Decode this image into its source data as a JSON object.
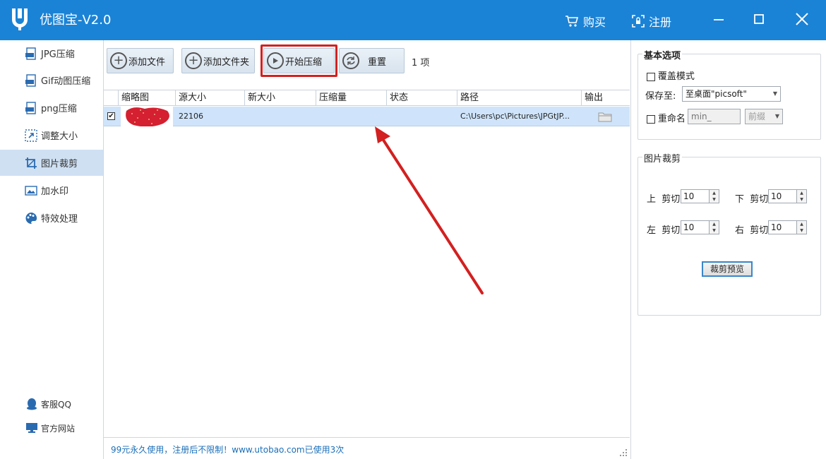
{
  "app": {
    "title": "优图宝-V2.0",
    "buy_label": "购买",
    "register_label": "注册"
  },
  "sidebar": {
    "items": [
      {
        "label": "JPG压缩",
        "icon": "jpg-icon"
      },
      {
        "label": "Gif动图压缩",
        "icon": "gif-icon"
      },
      {
        "label": "png压缩",
        "icon": "png-icon"
      },
      {
        "label": "调整大小",
        "icon": "resize-icon"
      },
      {
        "label": "图片裁剪",
        "icon": "crop-icon",
        "active": true
      },
      {
        "label": "加水印",
        "icon": "watermark-icon"
      },
      {
        "label": "特效处理",
        "icon": "palette-icon"
      }
    ],
    "bottom": [
      {
        "label": "客服QQ",
        "icon": "qq-icon"
      },
      {
        "label": "官方网站",
        "icon": "monitor-icon"
      }
    ]
  },
  "toolbar": {
    "add_file": "添加文件",
    "add_folder": "添加文件夹",
    "start": "开始压缩",
    "reset": "重置",
    "count": "1 项"
  },
  "table": {
    "columns": [
      "缩略图",
      "源大小",
      "新大小",
      "压缩量",
      "状态",
      "路径",
      "输出"
    ],
    "rows": [
      {
        "checked": true,
        "source_size": "22106",
        "new_size": "",
        "reduction": "",
        "status": "",
        "path": "C:\\Users\\pc\\Pictures\\JPGtJP..."
      }
    ]
  },
  "status_bar": {
    "text": "99元永久使用，注册后不限制！www.utobao.com已使用3次"
  },
  "basic_options": {
    "title": "基本选项",
    "overwrite_label": "覆盖模式",
    "save_to_label": "保存至:",
    "save_to_value": "至桌面\"picsoft\"",
    "rename_label": "重命名",
    "rename_placeholder": "min_",
    "prefix_value": "前缀"
  },
  "crop": {
    "title": "图片裁剪",
    "top_side": "上",
    "bottom_side": "下",
    "left_side": "左",
    "right_side": "右",
    "cut_label": "剪切:",
    "top_value": "10",
    "bottom_value": "10",
    "left_value": "10",
    "right_value": "10",
    "preview_button": "裁剪预览"
  },
  "colors": {
    "titlebar": "#1b83d6",
    "active_sidebar": "#cfe0f3",
    "selected_row": "#cfe4fa",
    "highlight": "#d32020",
    "link": "#1b6fb8"
  }
}
